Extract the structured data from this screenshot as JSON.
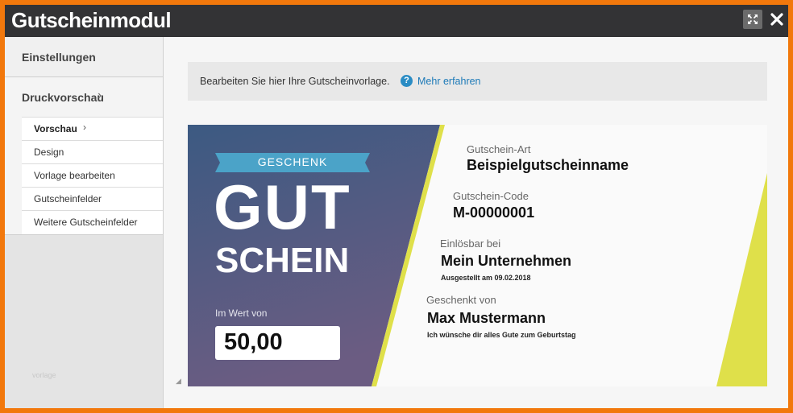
{
  "window": {
    "title": "Gutscheinmodul"
  },
  "sidebar": {
    "sections": [
      {
        "label": "Einstellungen"
      },
      {
        "label": "Druckvorschau"
      }
    ],
    "items": [
      {
        "label": "Vorschau"
      },
      {
        "label": "Design"
      },
      {
        "label": "Vorlage bearbeiten"
      },
      {
        "label": "Gutscheinfelder"
      },
      {
        "label": "Weitere Gutscheinfelder"
      }
    ],
    "footer": "vorlage"
  },
  "info": {
    "text": "Bearbeiten Sie hier Ihre Gutscheinvorlage.",
    "help_icon": "?",
    "link": "Mehr erfahren"
  },
  "voucher": {
    "ribbon": "GESCHENK",
    "big_line1": "GUT",
    "big_line2": "SCHEIN",
    "value_label": "Im Wert von",
    "value": "50,00",
    "type_label": "Gutschein-Art",
    "type_value": "Beispielgutscheinname",
    "code_label": "Gutschein-Code",
    "code_value": "M-00000001",
    "redeem_label": "Einlösbar bei",
    "redeem_value": "Mein Unternehmen",
    "issued": "Ausgestellt am 09.02.2018",
    "from_label": "Geschenkt von",
    "from_value": "Max Mustermann",
    "message": "Ich wünsche dir alles Gute zum Geburtstag"
  },
  "colors": {
    "accent_orange": "#f2780c",
    "titlebar": "#333335",
    "voucher_blue": "#3c5a82",
    "voucher_purple": "#6b5c82",
    "ribbon": "#4ba3c8",
    "stripe_yellow": "#dfe04a",
    "link": "#1d7ab8"
  }
}
